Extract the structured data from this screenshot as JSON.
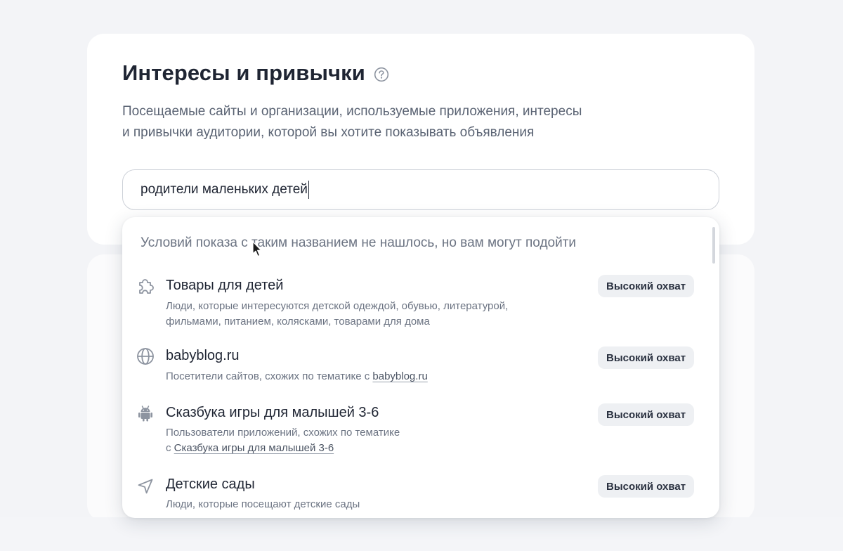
{
  "section": {
    "title": "Интересы и привычки",
    "help_icon": "question-circle-icon",
    "description_line1": "Посещаемые сайты и организации, используемые приложения, интересы",
    "description_line2": "и привычки аудитории, которой вы хотите показывать объявления"
  },
  "search": {
    "value": "родители маленьких детей"
  },
  "dropdown": {
    "notice": "Условий показа с таким названием не нашлось, но вам могут подойти",
    "items": [
      {
        "icon": "puzzle-icon",
        "title": "Товары для детей",
        "desc_line1": "Люди, которые интересуются детской одеждой, обувью, литературой,",
        "desc_line2": "фильмами, питанием, колясками, товарами для дома",
        "badge": "Высокий охват"
      },
      {
        "icon": "globe-icon",
        "title": "babyblog.ru",
        "desc_prefix": "Посетители сайтов, схожих по тематике с",
        "desc_link": "babyblog.ru",
        "badge": "Высокий охват"
      },
      {
        "icon": "android-icon",
        "title": "Сказбука игры для малышей 3-6",
        "desc_line1": "Пользователи приложений, схожих по тематике",
        "desc_prefix": "с",
        "desc_link": "Сказбука игры для малышей 3-6",
        "badge": "Высокий охват"
      },
      {
        "icon": "navigation-arrow-icon",
        "title": "Детские сады",
        "desc_line1": "Люди, которые посещают детские сады",
        "badge": "Высокий охват"
      }
    ]
  },
  "colors": {
    "page_background": "#f4f5f8",
    "card_background": "#ffffff",
    "text_primary": "#1f2533",
    "text_secondary": "#6b7382",
    "badge_background": "#eef0f3",
    "icon_color": "#8d94a0"
  }
}
